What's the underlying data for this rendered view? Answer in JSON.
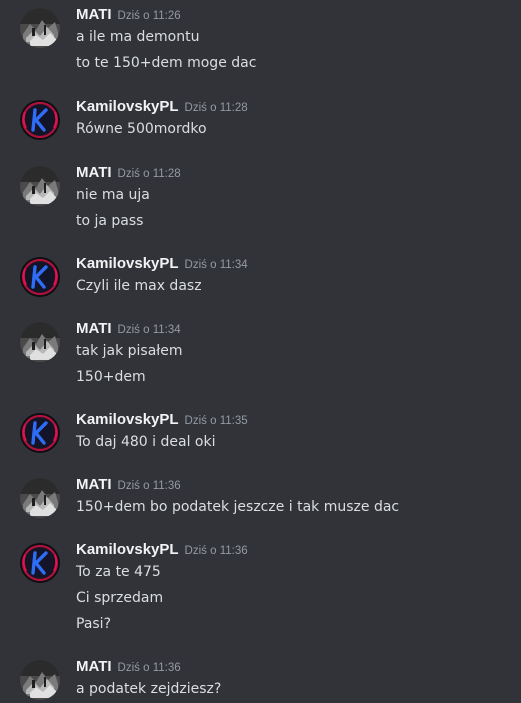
{
  "messages": [
    {
      "author": "MATI",
      "timestamp": "Dziś o 11:26",
      "avatar": "mati-avatar-icon",
      "lines": [
        "a ile ma demontu",
        "to te 150+dem moge dac"
      ]
    },
    {
      "author": "KamilovskyPL",
      "timestamp": "Dziś o 11:28",
      "avatar": "kamilovsky-avatar-icon",
      "lines": [
        "Równe 500mordko"
      ]
    },
    {
      "author": "MATI",
      "timestamp": "Dziś o 11:28",
      "avatar": "mati-avatar-icon",
      "lines": [
        "nie ma uja",
        "to ja pass"
      ]
    },
    {
      "author": "KamilovskyPL",
      "timestamp": "Dziś o 11:34",
      "avatar": "kamilovsky-avatar-icon",
      "lines": [
        "Czyli ile max dasz"
      ]
    },
    {
      "author": "MATI",
      "timestamp": "Dziś o 11:34",
      "avatar": "mati-avatar-icon",
      "lines": [
        "tak jak pisałem",
        "150+dem"
      ]
    },
    {
      "author": "KamilovskyPL",
      "timestamp": "Dziś o 11:35",
      "avatar": "kamilovsky-avatar-icon",
      "lines": [
        "To daj 480 i deal oki"
      ]
    },
    {
      "author": "MATI",
      "timestamp": "Dziś o 11:36",
      "avatar": "mati-avatar-icon",
      "lines": [
        "150+dem bo podatek jeszcze i tak musze dac"
      ]
    },
    {
      "author": "KamilovskyPL",
      "timestamp": "Dziś o 11:36",
      "avatar": "kamilovsky-avatar-icon",
      "lines": [
        "To za te 475",
        "Ci sprzedam",
        "Pasi?"
      ]
    },
    {
      "author": "MATI",
      "timestamp": "Dziś o 11:36",
      "avatar": "mati-avatar-icon",
      "lines": [
        "a podatek zejdziesz?"
      ]
    }
  ],
  "colors": {
    "background": "#313338",
    "username": "#f2f3f5",
    "timestamp": "#949ba4",
    "message_text": "#dbdee1",
    "kamilovsky_avatar_accent": "#2f6df6"
  }
}
